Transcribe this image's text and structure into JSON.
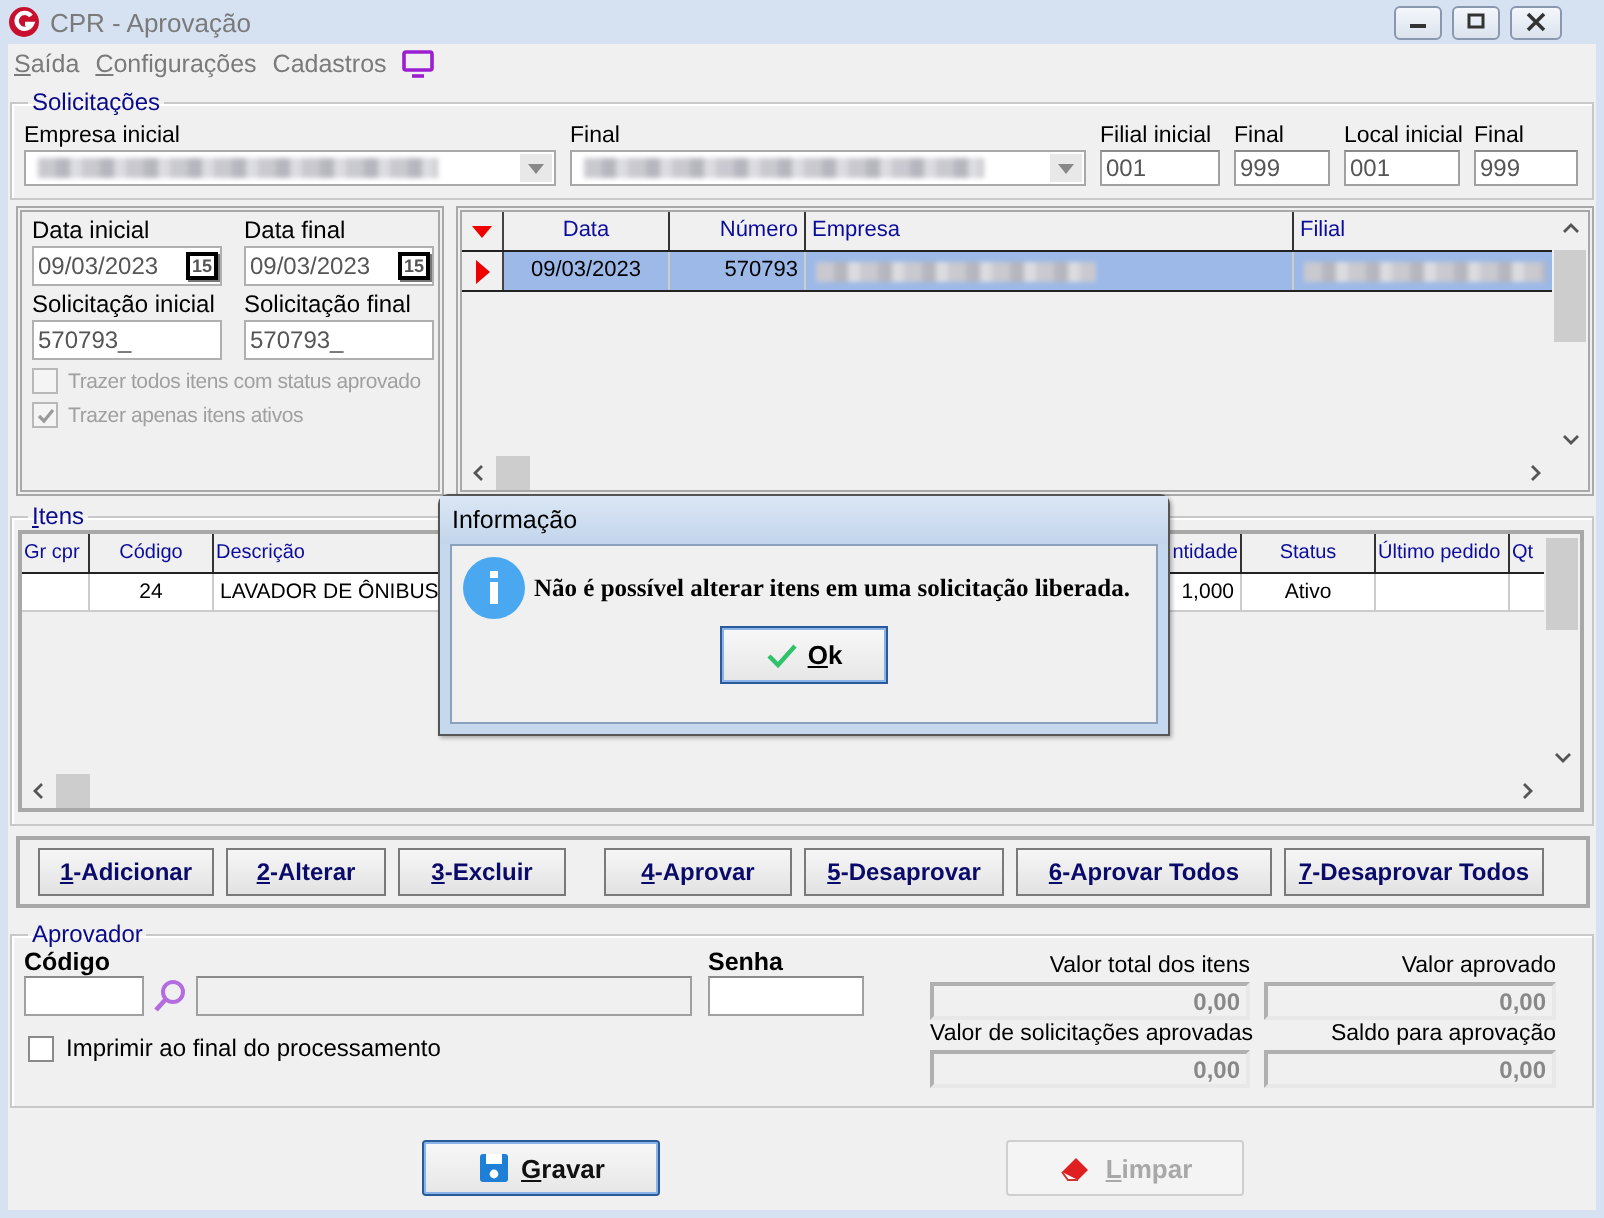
{
  "window": {
    "title": "CPR - Aprovação"
  },
  "menu": [
    {
      "label": "Saída"
    },
    {
      "label": "Configurações"
    },
    {
      "label": "Cadastros"
    }
  ],
  "solicitacoes": {
    "legend": "Solicitações",
    "fields": [
      {
        "label": "Empresa inicial",
        "kind": "combo",
        "redacted": true
      },
      {
        "label": "Final",
        "kind": "combo",
        "redacted": true
      },
      {
        "label": "Filial inicial",
        "kind": "text",
        "value": "001"
      },
      {
        "label": "Final",
        "kind": "text",
        "value": "999"
      },
      {
        "label": "Local inicial",
        "kind": "text",
        "value": "001"
      },
      {
        "label": "Final",
        "kind": "text",
        "value": "999"
      }
    ]
  },
  "filters": {
    "fields": [
      {
        "label": "Data inicial",
        "kind": "date",
        "value": "09/03/2023",
        "calendar": "15"
      },
      {
        "label": "Data final",
        "kind": "date",
        "value": "09/03/2023",
        "calendar": "15"
      },
      {
        "label": "Solicitação inicial",
        "kind": "text",
        "value": "570793_"
      },
      {
        "label": "Solicitação final",
        "kind": "text",
        "value": "570793_"
      }
    ],
    "checkboxes": [
      {
        "label": "Trazer todos itens com status aprovado",
        "checked": false,
        "disabled": true
      },
      {
        "label": "Trazer apenas itens ativos",
        "checked": true,
        "disabled": true
      }
    ]
  },
  "requests_table": {
    "columns": [
      "Data",
      "Número",
      "Empresa",
      "Filial"
    ],
    "rows": [
      {
        "selected": true,
        "cells": [
          {
            "text": "09/03/2023"
          },
          {
            "text": "570793"
          },
          {
            "redacted": true
          },
          {
            "redacted": true
          }
        ]
      }
    ]
  },
  "items": {
    "legend": "Itens",
    "columns": [
      "Gr cpr",
      "Código",
      "Descrição",
      "ntidade",
      "Status",
      "Último pedido",
      "Qt"
    ],
    "rows": [
      {
        "selected": false,
        "cells": [
          null,
          "24",
          "LAVADOR DE ÔNIBUS",
          "1,000",
          "Ativo",
          null,
          null
        ]
      }
    ]
  },
  "actions": [
    {
      "label": "1-Adicionar"
    },
    {
      "label": "2-Alterar"
    },
    {
      "label": "3-Excluir"
    },
    {
      "label": "4-Aprovar"
    },
    {
      "label": "5-Desaprovar"
    },
    {
      "label": "6-Aprovar Todos"
    },
    {
      "label": "7-Desaprovar Todos"
    }
  ],
  "aprovador": {
    "legend": "Aprovador",
    "codigo_label": "Código",
    "senha_label": "Senha",
    "checkbox": {
      "label": "Imprimir ao final do processamento",
      "checked": false
    },
    "totals": [
      {
        "label": "Valor total dos itens",
        "value": "0,00"
      },
      {
        "label": "Valor aprovado",
        "value": "0,00"
      },
      {
        "label": "Valor de solicitações aprovadas",
        "value": "0,00"
      },
      {
        "label": "Saldo para aprovação",
        "value": "0,00"
      }
    ]
  },
  "footer_buttons": [
    {
      "label": "Gravar",
      "kind": "save",
      "disabled": false
    },
    {
      "label": "Limpar",
      "kind": "eraser",
      "disabled": true
    }
  ],
  "dialog": {
    "title": "Informação",
    "message": "Não é possível alterar itens em uma solicitação liberada.",
    "button": {
      "label": "Ok"
    }
  }
}
